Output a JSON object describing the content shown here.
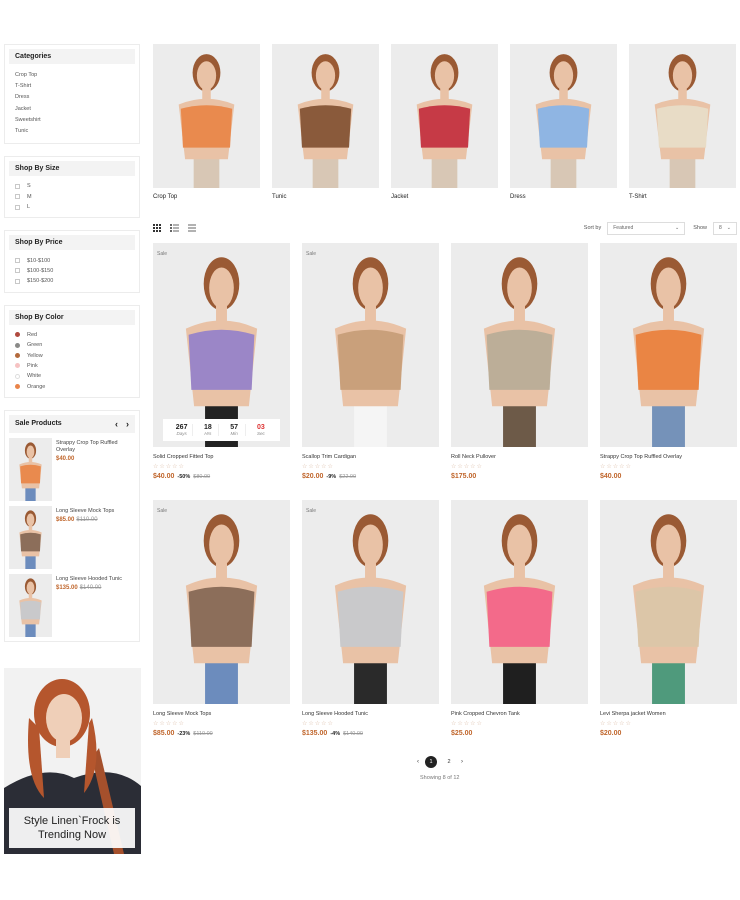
{
  "sidebar": {
    "categories": {
      "title": "Categories",
      "items": [
        "Crop Top",
        "T-Shirt",
        "Dress",
        "Jacket",
        "Sweetshirt",
        "Tunic"
      ]
    },
    "size": {
      "title": "Shop By Size",
      "items": [
        "S",
        "M",
        "L"
      ]
    },
    "price": {
      "title": "Shop By Price",
      "items": [
        "$10-$100",
        "$100-$150",
        "$150-$200"
      ]
    },
    "color": {
      "title": "Shop By Color",
      "items": [
        {
          "label": "Red",
          "color": "#b04a3f"
        },
        {
          "label": "Green",
          "color": "#8a8a88"
        },
        {
          "label": "Yellow",
          "color": "#b36a3d"
        },
        {
          "label": "Pink",
          "color": "#f6c3c3"
        },
        {
          "label": "White",
          "color": "#ffffff"
        },
        {
          "label": "Orange",
          "color": "#e9844a"
        }
      ]
    },
    "sale_products": {
      "title": "Sale Products",
      "prev_icon": "chevron-left-icon",
      "next_icon": "chevron-right-icon",
      "items": [
        {
          "name": "Strappy Crop Top Ruffled Overlay",
          "price": "$40.00",
          "old_price": ""
        },
        {
          "name": "Long Sleeve Mock Tops",
          "price": "$85.00",
          "old_price": "$110.00"
        },
        {
          "name": "Long Sleeve Hooded Tunic",
          "price": "$135.00",
          "old_price": "$140.00"
        }
      ]
    },
    "promo": {
      "text": "Style Linen`Frock is Trending Now"
    }
  },
  "category_tiles": [
    {
      "label": "Crop Top",
      "garment": "#e98a4e"
    },
    {
      "label": "Tunic",
      "garment": "#8a5a3b"
    },
    {
      "label": "Jacket",
      "garment": "#c63a46"
    },
    {
      "label": "Dress",
      "garment": "#8fb5e3"
    },
    {
      "label": "T-Shirt",
      "garment": "#e8dcc6"
    }
  ],
  "toolbar": {
    "sort_label": "Sort by",
    "sort_value": "Featured",
    "show_label": "Show",
    "show_value": "8"
  },
  "products": [
    {
      "name": "Solid Cropped Fitted Top",
      "price": "$40.00",
      "discount": "-50%",
      "old_price": "$80.00",
      "badge": "Sale",
      "garment": "#9b86c7",
      "pants": "#222222"
    },
    {
      "name": "Scallop Trim Cardigan",
      "price": "$20.00",
      "discount": "-9%",
      "old_price": "$22.00",
      "badge": "Sale",
      "garment": "#c9a07b",
      "pants": "#f5f5f5"
    },
    {
      "name": "Roll Neck Pullover",
      "price": "$175.00",
      "discount": "",
      "old_price": "",
      "badge": "",
      "garment": "#bcae98",
      "pants": "#6d5a48"
    },
    {
      "name": "Strappy Crop Top Ruffled Overlay",
      "price": "$40.00",
      "discount": "",
      "old_price": "",
      "badge": "",
      "garment": "#ea8544",
      "pants": "#7592b9"
    },
    {
      "name": "Long Sleeve Mock Tops",
      "price": "$85.00",
      "discount": "-23%",
      "old_price": "$110.00",
      "badge": "Sale",
      "garment": "#8c6e5a",
      "pants": "#6c8cbd"
    },
    {
      "name": "Long Sleeve Hooded Tunic",
      "price": "$135.00",
      "discount": "-4%",
      "old_price": "$140.00",
      "badge": "Sale",
      "garment": "#c9c9cb",
      "pants": "#2a2a2a"
    },
    {
      "name": "Pink Cropped Chevron Tank",
      "price": "$25.00",
      "discount": "",
      "old_price": "",
      "badge": "",
      "garment": "#f36a8a",
      "pants": "#1f1f1f"
    },
    {
      "name": "Levi Sherpa jacket Women",
      "price": "$20.00",
      "discount": "",
      "old_price": "",
      "badge": "",
      "garment": "#dcc6a8",
      "pants": "#4f9a7c"
    }
  ],
  "countdown": {
    "days": "267",
    "days_label": "Days",
    "hrs": "18",
    "hrs_label": "Hrs",
    "min": "57",
    "min_label": "Min",
    "sec": "03",
    "sec_label": "Sec"
  },
  "pagination": {
    "prev": "‹",
    "pages": [
      "1",
      "2"
    ],
    "next": "›",
    "showing": "Showing 8 of 12"
  },
  "colors": {
    "accent": "#c0662c",
    "skin": "#e9c2a6",
    "hair": "#9a5a34",
    "photo_bg": "#ececec"
  }
}
